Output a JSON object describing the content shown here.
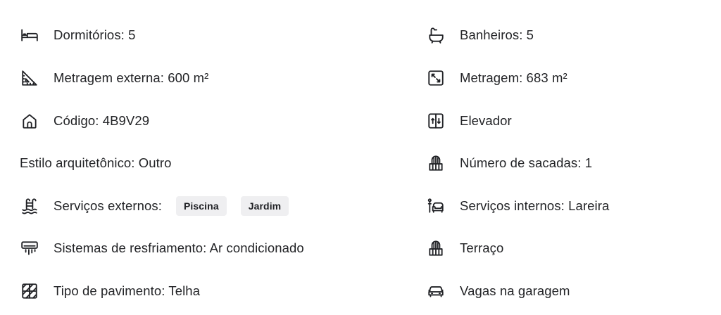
{
  "features": {
    "bedrooms": "Dormitórios: 5",
    "bathrooms": "Banheiros: 5",
    "external_area": "Metragem externa: 600 m²",
    "area": "Metragem: 683 m²",
    "code": "Código: 4B9V29",
    "elevator": "Elevador",
    "architectural_style": "Estilo arquitetônico: Outro",
    "balconies": "Número de sacadas: 1",
    "external_services_label": "Serviços externos:",
    "external_services": [
      "Piscina",
      "Jardim"
    ],
    "internal_services": "Serviços internos: Lareira",
    "cooling": "Sistemas de resfriamento: Ar condicionado",
    "terrace": "Terraço",
    "flooring": "Tipo de pavimento: Telha",
    "garage": "Vagas na garagem"
  },
  "icons": {
    "bedrooms": "bed-icon",
    "bathrooms": "bathtub-icon",
    "external_area": "ruler-triangle-icon",
    "area": "expand-arrows-icon",
    "code": "house-icon",
    "elevator": "elevator-icon",
    "balconies": "balcony-icon",
    "external_services": "pool-icon",
    "internal_services": "fireplace-armchair-icon",
    "cooling": "air-conditioner-icon",
    "terrace": "terrace-icon",
    "flooring": "floor-tile-icon",
    "garage": "car-icon"
  }
}
